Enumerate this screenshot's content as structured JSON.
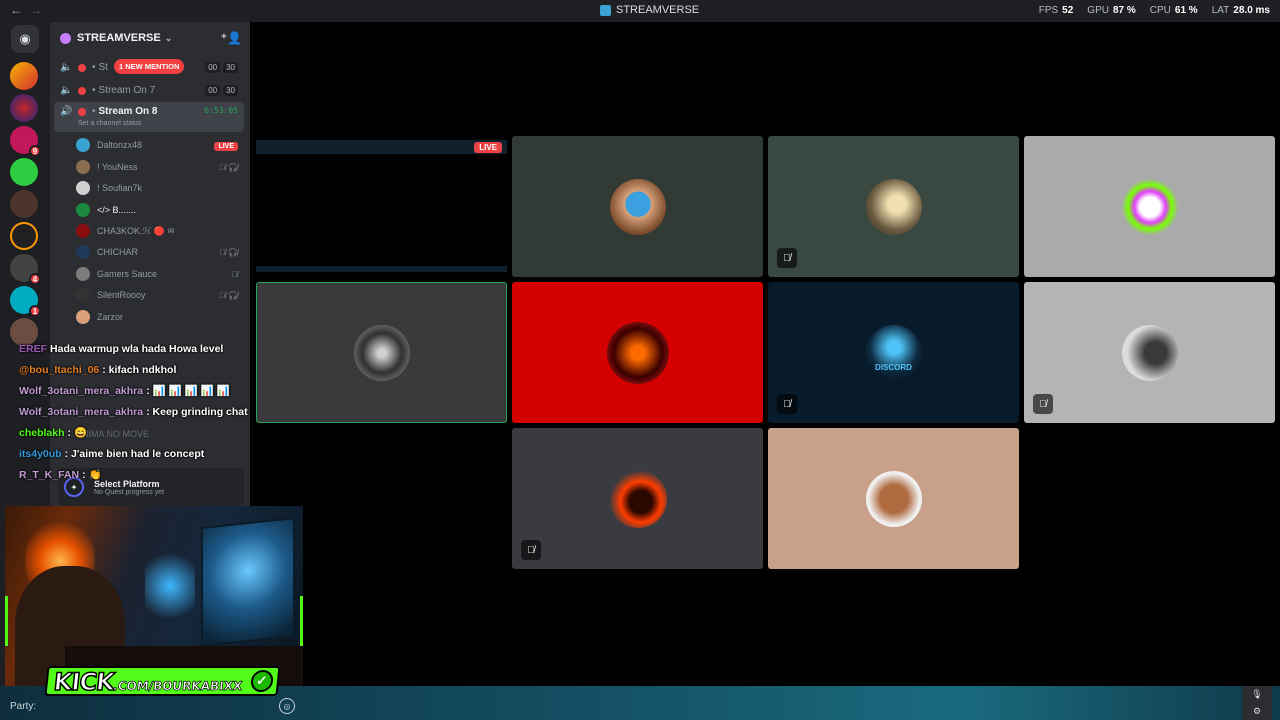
{
  "titlebar": {
    "back": "←",
    "forward": "→",
    "title": "STREAMVERSE",
    "stats": [
      {
        "k": "FPS",
        "v": "52"
      },
      {
        "k": "GPU",
        "v": "87 %"
      },
      {
        "k": "CPU",
        "v": "61 %"
      },
      {
        "k": "LAT",
        "v": "28.0 ms"
      }
    ]
  },
  "server": {
    "name": "STREAMVERSE",
    "new_mention": "1 NEW MENTION"
  },
  "channels": [
    {
      "name": "St",
      "tags": [
        "00",
        "30"
      ]
    },
    {
      "name": "Stream On 7",
      "tags": [
        "00",
        "30"
      ]
    },
    {
      "name": "Stream On 8",
      "timer": "6:53:05",
      "status": "Set a channel status"
    }
  ],
  "members": [
    {
      "name": "Daltonzx48",
      "live": "LIVE",
      "color": "#3ba3d4"
    },
    {
      "name": "! YouNess",
      "right": "🎙̸ 🎧̸",
      "color": "#8a6d4f"
    },
    {
      "name": "! Soufian7k",
      "right": "",
      "color": "#d0d0d0"
    },
    {
      "name": "</> B.......",
      "right": "",
      "color": "#1b8a3e"
    },
    {
      "name": "CHA3KOK.ℋ 🔴 ᵍᵍ",
      "right": "",
      "color": "#8a0e0e"
    },
    {
      "name": "CHICHAR",
      "right": "🎙̸ 🎧̸",
      "color": "#203a5a"
    },
    {
      "name": "Gamers Sauce",
      "right": "🎙̸",
      "color": "#7d7d7d"
    },
    {
      "name": "SilentRoooy",
      "right": "🎙̸ 🎧̸",
      "color": "#333"
    },
    {
      "name": "Zarzor",
      "right": "",
      "color": "#d9a07a"
    }
  ],
  "quest": {
    "title": "Select Platform",
    "subtitle": "No Quest progress yet"
  },
  "chat": [
    {
      "user": "EREF",
      "user_color": "#9b59b6",
      "text": "Hada warmup wla hada Howa level"
    },
    {
      "user": "@bou_Itachi_06",
      "user_color": "#e67e22",
      "text": ": kifach ndkhol"
    },
    {
      "user": "Wolf_3otani_mera_akhra",
      "user_color": "#c39bd3",
      "text": ": 📊 📊 📊 📊 📊"
    },
    {
      "user": "Wolf_3otani_mera_akhra",
      "user_color": "#c39bd3",
      "text": ": Keep grinding chat"
    },
    {
      "user": "cheblakh",
      "user_color": "#53fc18",
      "text": ": 😄"
    },
    {
      "user": "its4y0ub",
      "user_color": "#3498db",
      "text": ": J'aime bien had le concept"
    },
    {
      "user": "R_T_K_FAN",
      "user_color": "#c39bd3",
      "text": ": 👏"
    }
  ],
  "overlay_ghost_text": "ENIMA NO MOVE",
  "kick": {
    "brand": "KICK",
    "handle": ".COM/BOURKABIXX",
    "check": "✓"
  },
  "screen_share": {
    "live": "LIVE"
  },
  "tiles_text": {
    "discord": "DISCORD"
  },
  "bottombar": {
    "party_label": "Party:"
  },
  "colors": {
    "accent_green": "#23a55a",
    "kick_green": "#53fc18",
    "live_red": "#ed4245"
  }
}
